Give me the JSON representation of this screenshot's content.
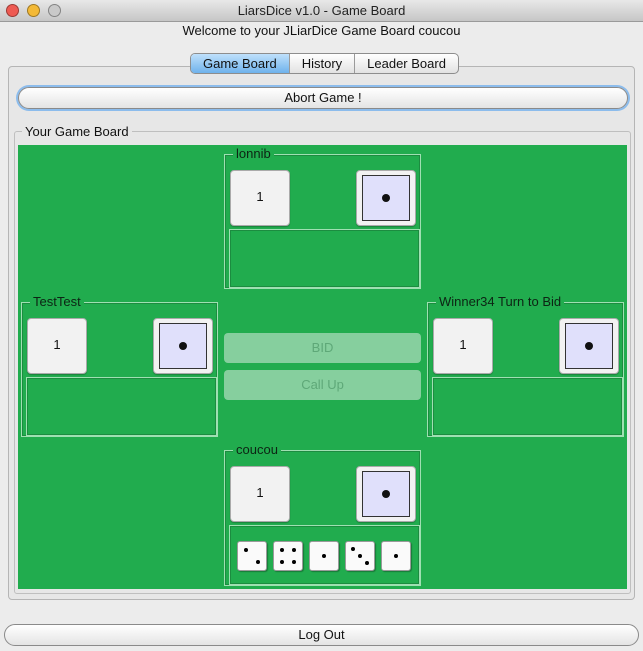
{
  "window": {
    "title": "LiarsDice v1.0 - Game Board",
    "welcome": "Welcome to your JLiarDice Game Board coucou"
  },
  "tabs": [
    {
      "label": "Game Board",
      "active": true
    },
    {
      "label": "History",
      "active": false
    },
    {
      "label": "Leader Board",
      "active": false
    }
  ],
  "abort_label": "Abort Game !",
  "board": {
    "legend": "Your Game Board",
    "background_color": "#21ac4e",
    "players": {
      "top": {
        "name": "lonnib",
        "bid_count": "1",
        "bid_face": 1
      },
      "left": {
        "name": "TestTest",
        "bid_count": "1",
        "bid_face": 1
      },
      "right": {
        "name": "Winner34 Turn to Bid",
        "bid_count": "1",
        "bid_face": 1
      },
      "bottom": {
        "name": "coucou",
        "bid_count": "1",
        "bid_face": 1,
        "dice": [
          2,
          4,
          1,
          3,
          1
        ]
      }
    },
    "bid_label": "BID",
    "callup_label": "Call Up"
  },
  "logout_label": "Log Out",
  "icons": {
    "close": "close-icon",
    "minimize": "minimize-icon",
    "zoom": "zoom-icon",
    "die": "die-icon"
  }
}
